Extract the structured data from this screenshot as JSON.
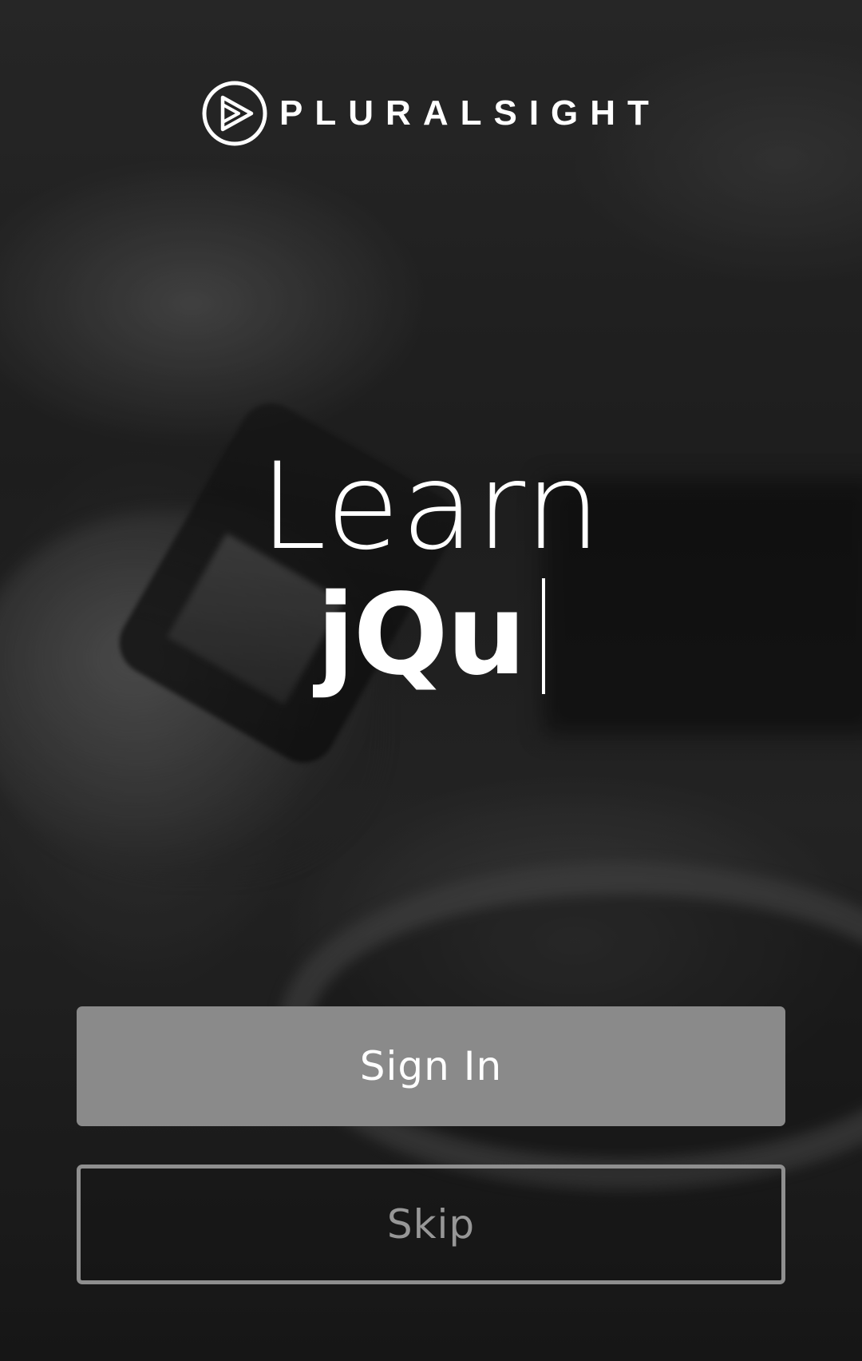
{
  "brand": {
    "name": "PLURALSIGHT",
    "logo_icon": "play-circle-icon"
  },
  "headline": {
    "line1": "Learn",
    "typed_text": "jQu",
    "caret_icon": "text-caret"
  },
  "actions": {
    "sign_in_label": "Sign In",
    "skip_label": "Skip"
  },
  "colors": {
    "sign_in_bg": "#8a8a8a",
    "skip_border": "#8f8f8f",
    "skip_text": "#979797",
    "text": "#ffffff"
  }
}
